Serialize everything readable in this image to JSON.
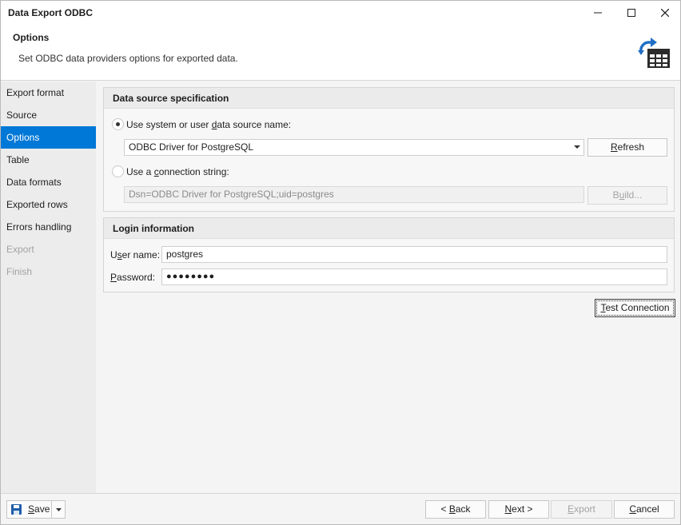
{
  "window": {
    "title": "Data Export ODBC"
  },
  "header": {
    "title": "Options",
    "description": "Set ODBC data providers options for exported data.",
    "icon": "export-table-icon"
  },
  "sidebar": {
    "items": [
      {
        "label": "Export format",
        "state": "normal"
      },
      {
        "label": "Source",
        "state": "normal"
      },
      {
        "label": "Options",
        "state": "active"
      },
      {
        "label": "Table",
        "state": "normal"
      },
      {
        "label": "Data formats",
        "state": "normal"
      },
      {
        "label": "Exported rows",
        "state": "normal"
      },
      {
        "label": "Errors handling",
        "state": "normal"
      },
      {
        "label": "Export",
        "state": "disabled"
      },
      {
        "label": "Finish",
        "state": "disabled"
      }
    ]
  },
  "datasource": {
    "heading": "Data source specification",
    "dsn_radio_pre": "Use system or user ",
    "dsn_radio_u": "d",
    "dsn_radio_post": "ata source name:",
    "dsn_selected": true,
    "dsn_value": "ODBC Driver for PostgreSQL",
    "refresh_pre": "",
    "refresh_u": "R",
    "refresh_post": "efresh",
    "conn_radio_pre": "Use a ",
    "conn_radio_u": "c",
    "conn_radio_post": "onnection string:",
    "conn_value": "Dsn=ODBC Driver for PostgreSQL;uid=postgres",
    "build_pre": "B",
    "build_u": "u",
    "build_post": "ild..."
  },
  "login": {
    "heading": "Login information",
    "username_label_pre": "U",
    "username_label_u": "s",
    "username_label_post": "er name:",
    "username_value": "postgres",
    "password_label_pre": "",
    "password_label_u": "P",
    "password_label_post": "assword:",
    "password_value": "●●●●●●●●"
  },
  "test_connection": {
    "pre": "",
    "u": "T",
    "post": "est Connection"
  },
  "footer": {
    "save_pre": "",
    "save_u": "S",
    "save_post": "ave",
    "back_pre": "< ",
    "back_u": "B",
    "back_post": "ack",
    "next_pre": "",
    "next_u": "N",
    "next_post": "ext >",
    "export_pre": "",
    "export_u": "E",
    "export_post": "xport",
    "cancel_pre": "",
    "cancel_u": "C",
    "cancel_post": "ancel"
  },
  "colors": {
    "accent": "#0078d7",
    "icon_blue": "#1f6fc5",
    "icon_dark": "#2b2b2b"
  }
}
